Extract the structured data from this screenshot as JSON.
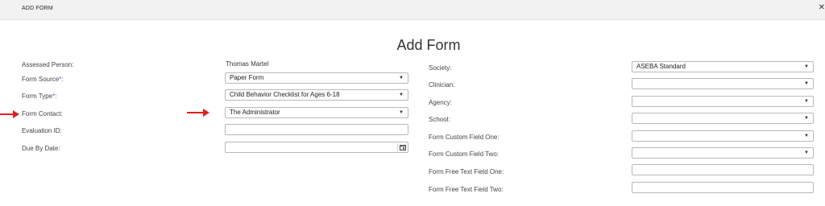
{
  "header": {
    "title": "ADD FORM",
    "close_icon": "close-icon"
  },
  "page_title": "Add Form",
  "left_form": {
    "assessed_person_label": "Assessed Person:",
    "assessed_person_value": "Thomas Martel",
    "form_source_label": "Form Source",
    "form_source_value": "Paper Form",
    "form_type_label": "Form Type",
    "form_type_value": "Child Behavior Checklist for Ages 6-18",
    "form_contact_label": "Form Contact:",
    "form_contact_value": "The Administrator",
    "evaluation_id_label": "Evaluation ID:",
    "evaluation_id_value": "",
    "due_by_date_label": "Due By Date:",
    "due_by_date_value": "",
    "required_marker": "*",
    "colon": ":"
  },
  "right_form": {
    "society_label": "Society:",
    "society_value": "ASEBA Standard",
    "clinician_label": "Clinician:",
    "clinician_value": "",
    "agency_label": "Agency:",
    "agency_value": "",
    "school_label": "School:",
    "school_value": "",
    "custom_one_label": "Form Custom Field One:",
    "custom_one_value": "",
    "custom_two_label": "Form Custom Field Two:",
    "custom_two_value": "",
    "free_text_one_label": "Form Free Text Field One:",
    "free_text_one_value": "",
    "free_text_two_label": "Form Free Text Field Two:",
    "free_text_two_value": ""
  },
  "icons": {
    "dropdown": "chevron-down-icon",
    "calendar": "calendar-icon",
    "annotation_arrow": "red-arrow-icon"
  },
  "colors": {
    "annotation_arrow": "#e02020",
    "required_marker": "#2c6ad6"
  }
}
